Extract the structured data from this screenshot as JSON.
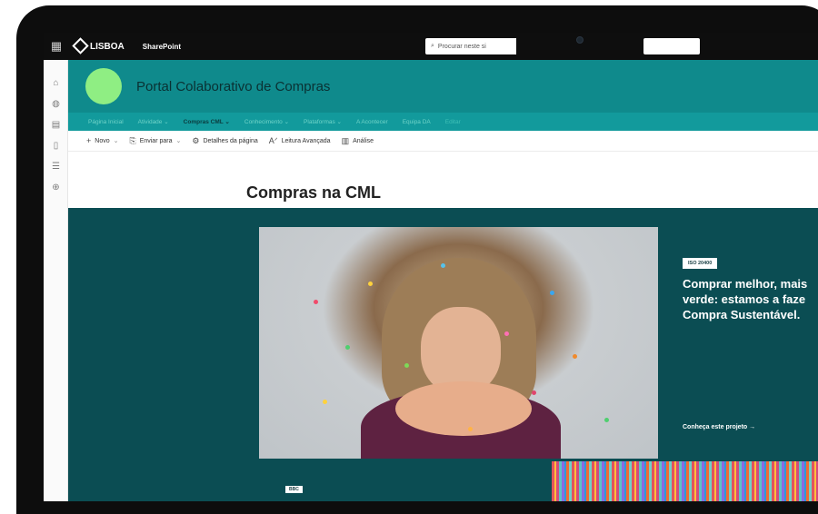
{
  "suitebar": {
    "brand": "LISBOA",
    "app": "SharePoint",
    "search_placeholder": "Procurar neste si"
  },
  "site": {
    "title": "Portal Colaborativo de Compras",
    "logo_color": "#8fee83",
    "header_color": "#0f8a8c"
  },
  "nav": {
    "items": [
      {
        "label": "Página Inicial"
      },
      {
        "label": "Atividade ⌄"
      },
      {
        "label": "Compras CML ⌄"
      },
      {
        "label": "Conhecimento ⌄"
      },
      {
        "label": "Plataformas ⌄"
      },
      {
        "label": "A Acontecer"
      },
      {
        "label": "Equipa DA"
      },
      {
        "label": "Editar"
      }
    ]
  },
  "commands": {
    "new": "Novo",
    "send": "Enviar para",
    "details": "Detalhes da página",
    "reader": "Leitura Avançada",
    "analytics": "Análise"
  },
  "page": {
    "title": "Compras na CML"
  },
  "hero": {
    "tag": "ISO 20400",
    "headline": "Comprar melhor, mais\nverde: estamos a faze\nCompra Sustentável.",
    "link": "Conheça este projeto →",
    "tag2": "BBC",
    "bg_color": "#0b4d53"
  }
}
